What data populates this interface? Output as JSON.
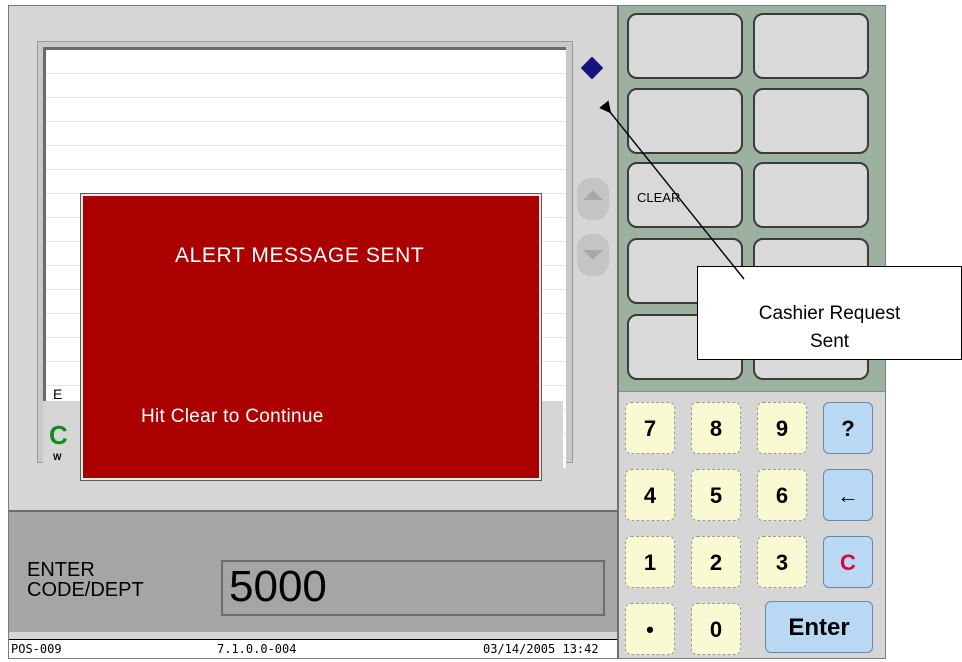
{
  "receipt": {
    "partial_e": "E",
    "partial_c": "C",
    "partial_w": "W"
  },
  "function_keys": {
    "clear_label": "CLEAR"
  },
  "keypad": {
    "k7": "7",
    "k8": "8",
    "k9": "9",
    "help": "?",
    "k4": "4",
    "k5": "5",
    "k6": "6",
    "backspace": "←",
    "k1": "1",
    "k2": "2",
    "k3": "3",
    "cancel": "C",
    "dot": "•",
    "k0": "0",
    "enter": "Enter"
  },
  "entry": {
    "label_line1": "ENTER",
    "label_line2": "CODE/DEPT",
    "value": "5000"
  },
  "status_bar": {
    "terminal": "POS-009",
    "version": "7.1.0.0-004",
    "datetime": "03/14/2005 13:42"
  },
  "alert": {
    "title": "ALERT MESSAGE SENT",
    "message": "Hit Clear to Continue"
  },
  "annotation": {
    "line1": "Cashier Request",
    "line2": "Sent"
  },
  "colors": {
    "alert_bg": "#aa0000",
    "indicator": "#14147d",
    "cancel_key_text": "#e0003c"
  }
}
